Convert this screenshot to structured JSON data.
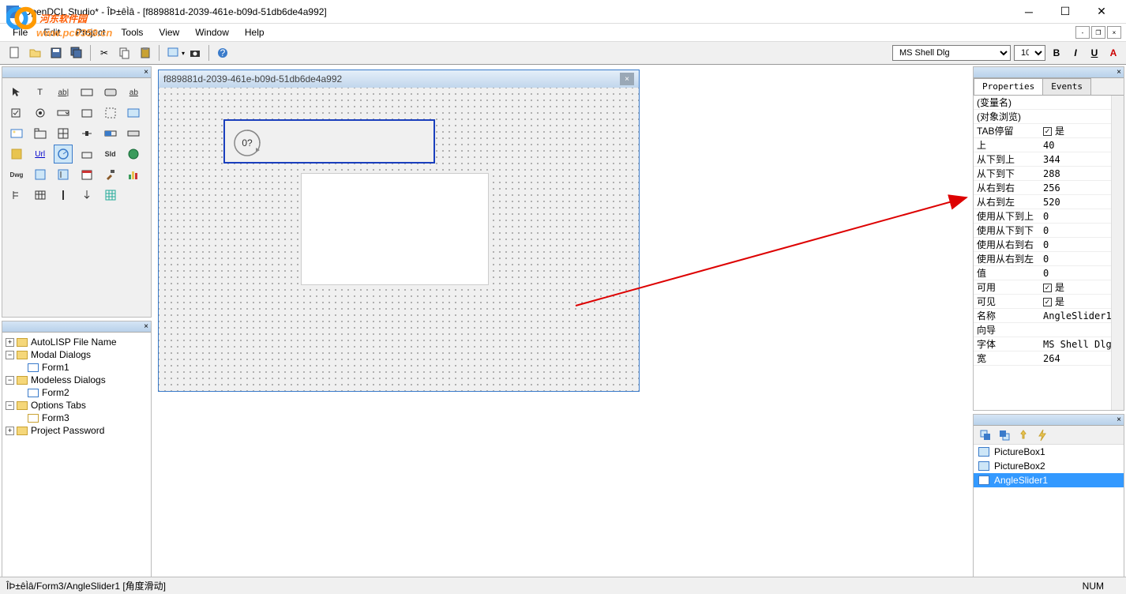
{
  "watermark": {
    "text": "河东软件园",
    "url": "www.pc0359.cn"
  },
  "title": "OpenDCL Studio* - ÎÞ±êÌâ - [f889881d-2039-461e-b09d-51db6de4a992]",
  "menu": {
    "file": "File",
    "edit": "Edit",
    "project": "Project",
    "tools": "Tools",
    "view": "View",
    "window": "Window",
    "help": "Help"
  },
  "font": {
    "name": "MS Shell Dlg",
    "size": "10"
  },
  "designer": {
    "title": "f889881d-2039-461e-b09d-51db6de4a992",
    "angle_text": "0?"
  },
  "tree": {
    "n0": "AutoLISP File Name",
    "n1": "Modal Dialogs",
    "n1_0": "Form1",
    "n2": "Modeless Dialogs",
    "n2_0": "Form2",
    "n3": "Options Tabs",
    "n3_0": "Form3",
    "n4": "Project Password"
  },
  "tabs": {
    "properties": "Properties",
    "events": "Events"
  },
  "props": [
    {
      "name": "(变量名)",
      "val": ""
    },
    {
      "name": "(对象浏览)",
      "val": ""
    },
    {
      "name": "TAB停留",
      "val": "☑是",
      "cb": true
    },
    {
      "name": "上",
      "val": "40"
    },
    {
      "name": "从下到上",
      "val": "344"
    },
    {
      "name": "从下到下",
      "val": "288"
    },
    {
      "name": "从右到右",
      "val": "256"
    },
    {
      "name": "从右到左",
      "val": "520"
    },
    {
      "name": "使用从下到上",
      "val": "0"
    },
    {
      "name": "使用从下到下",
      "val": "0"
    },
    {
      "name": "使用从右到右",
      "val": "0"
    },
    {
      "name": "使用从右到左",
      "val": "0"
    },
    {
      "name": "值",
      "val": "0"
    },
    {
      "name": "可用",
      "val": "☑是",
      "cb": true
    },
    {
      "name": "可见",
      "val": "☑是",
      "cb": true
    },
    {
      "name": "名称",
      "val": "AngleSlider1"
    },
    {
      "name": "向导",
      "val": ""
    },
    {
      "name": "字体",
      "val": "MS Shell Dlg"
    },
    {
      "name": "宽",
      "val": "264"
    }
  ],
  "objects": {
    "o1": "PictureBox1",
    "o2": "PictureBox2",
    "o3": "AngleSlider1"
  },
  "status": {
    "path": "ÎÞ±êÌâ/Form3/AngleSlider1 [角度滑动]",
    "num": "NUM"
  }
}
